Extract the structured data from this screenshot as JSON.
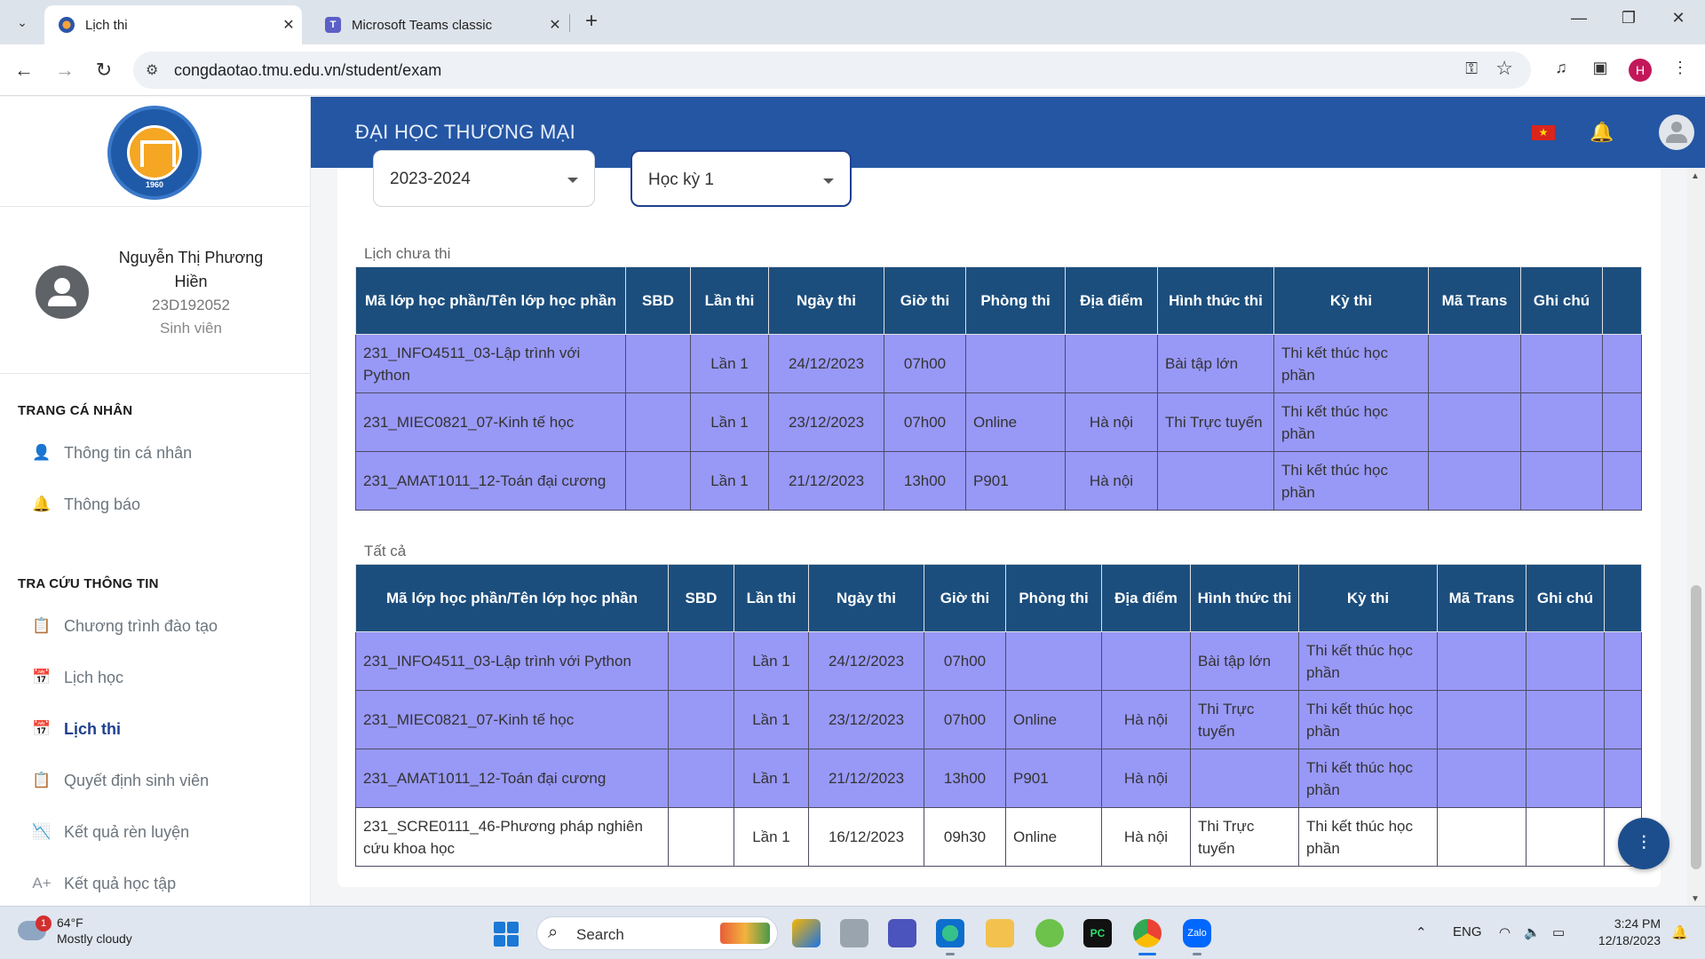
{
  "browser": {
    "tabs": [
      {
        "title": "Lịch thi",
        "active": true,
        "icon": "tmu-favicon-icon"
      },
      {
        "title": "Microsoft Teams classic",
        "active": false,
        "icon": "teams-icon"
      }
    ],
    "url": "congdaotao.tmu.edu.vn/student/exam",
    "profile_initial": "H"
  },
  "header": {
    "title": "ĐẠI HỌC THƯƠNG MẠI",
    "colors": {
      "header_bg": "#2456a4",
      "table_header": "#1c4e7d",
      "row_highlight": "#9898f7"
    }
  },
  "sidebar": {
    "logo_year": "1960",
    "user": {
      "name": "Nguyễn Thị Phương Hiền",
      "student_id": "23D192052",
      "role": "Sinh viên"
    },
    "sections": [
      {
        "title": "TRANG CÁ NHÂN",
        "items": [
          {
            "label": "Thông tin cá nhân",
            "icon": "person-icon"
          },
          {
            "label": "Thông báo",
            "icon": "bell-icon"
          }
        ]
      },
      {
        "title": "TRA CỨU THÔNG TIN",
        "items": [
          {
            "label": "Chương trình đào tạo",
            "icon": "clipboard-icon"
          },
          {
            "label": "Lịch học",
            "icon": "calendar-icon"
          },
          {
            "label": "Lịch thi",
            "icon": "calendar-icon",
            "active": true
          },
          {
            "label": "Quyết định sinh viên",
            "icon": "clipboard-icon"
          },
          {
            "label": "Kết quả rèn luyện",
            "icon": "chart-icon"
          },
          {
            "label": "Kết quả học tập",
            "icon": "grade-icon"
          }
        ]
      }
    ]
  },
  "filters": {
    "year": "2023-2024",
    "term": "Học kỳ 1"
  },
  "pending": {
    "label": "Lịch chưa thi",
    "columns": [
      "Mã lớp học phần/Tên lớp học phần",
      "SBD",
      "Lần thi",
      "Ngày thi",
      "Giờ thi",
      "Phòng thi",
      "Địa điểm",
      "Hình thức thi",
      "Kỳ thi",
      "Mã Trans",
      "Ghi chú"
    ],
    "rows": [
      {
        "course": "231_INFO4511_03-Lập trình với Python",
        "sbd": "",
        "attempt": "Lần 1",
        "date": "24/12/2023",
        "time": "07h00",
        "room": "",
        "place": "",
        "form": "Bài tập lớn",
        "exam": "Thi kết thúc học phần",
        "trans": "",
        "note": ""
      },
      {
        "course": "231_MIEC0821_07-Kinh tế học",
        "sbd": "",
        "attempt": "Lần 1",
        "date": "23/12/2023",
        "time": "07h00",
        "room": "Online",
        "place": "Hà nội",
        "form": "Thi Trực tuyến",
        "exam": "Thi kết thúc học phần",
        "trans": "",
        "note": ""
      },
      {
        "course": "231_AMAT1011_12-Toán đại cương",
        "sbd": "",
        "attempt": "Lần 1",
        "date": "21/12/2023",
        "time": "13h00",
        "room": "P901",
        "place": "Hà nội",
        "form": "",
        "exam": "Thi kết thúc học phần",
        "trans": "",
        "note": ""
      }
    ]
  },
  "all": {
    "label": "Tất cả",
    "columns": [
      "Mã lớp học phần/Tên lớp học phần",
      "SBD",
      "Lần thi",
      "Ngày thi",
      "Giờ thi",
      "Phòng thi",
      "Địa điểm",
      "Hình thức thi",
      "Kỳ thi",
      "Mã Trans",
      "Ghi chú"
    ],
    "rows": [
      {
        "course": "231_INFO4511_03-Lập trình với Python",
        "sbd": "",
        "attempt": "Lần 1",
        "date": "24/12/2023",
        "time": "07h00",
        "room": "",
        "place": "",
        "form": "Bài tập lớn",
        "exam": "Thi kết thúc học phần",
        "trans": "",
        "note": "",
        "highlight": true
      },
      {
        "course": "231_MIEC0821_07-Kinh tế học",
        "sbd": "",
        "attempt": "Lần 1",
        "date": "23/12/2023",
        "time": "07h00",
        "room": "Online",
        "place": "Hà nội",
        "form": "Thi Trực tuyến",
        "exam": "Thi kết thúc học phần",
        "trans": "",
        "note": "",
        "highlight": true
      },
      {
        "course": "231_AMAT1011_12-Toán đại cương",
        "sbd": "",
        "attempt": "Lần 1",
        "date": "21/12/2023",
        "time": "13h00",
        "room": "P901",
        "place": "Hà nội",
        "form": "",
        "exam": "Thi kết thúc học phần",
        "trans": "",
        "note": "",
        "highlight": true
      },
      {
        "course": "231_SCRE0111_46-Phương pháp nghiên cứu khoa học",
        "sbd": "",
        "attempt": "Lần 1",
        "date": "16/12/2023",
        "time": "09h30",
        "room": "Online",
        "place": "Hà nội",
        "form": "Thi Trực tuyến",
        "exam": "Thi kết thúc học phần",
        "trans": "",
        "note": "",
        "highlight": false
      }
    ]
  },
  "taskbar": {
    "weather": {
      "badge": "1",
      "temp": "64°F",
      "condition": "Mostly cloudy"
    },
    "search_label": "Search",
    "lang": "ENG",
    "time": "3:24 PM",
    "date": "12/18/2023"
  }
}
